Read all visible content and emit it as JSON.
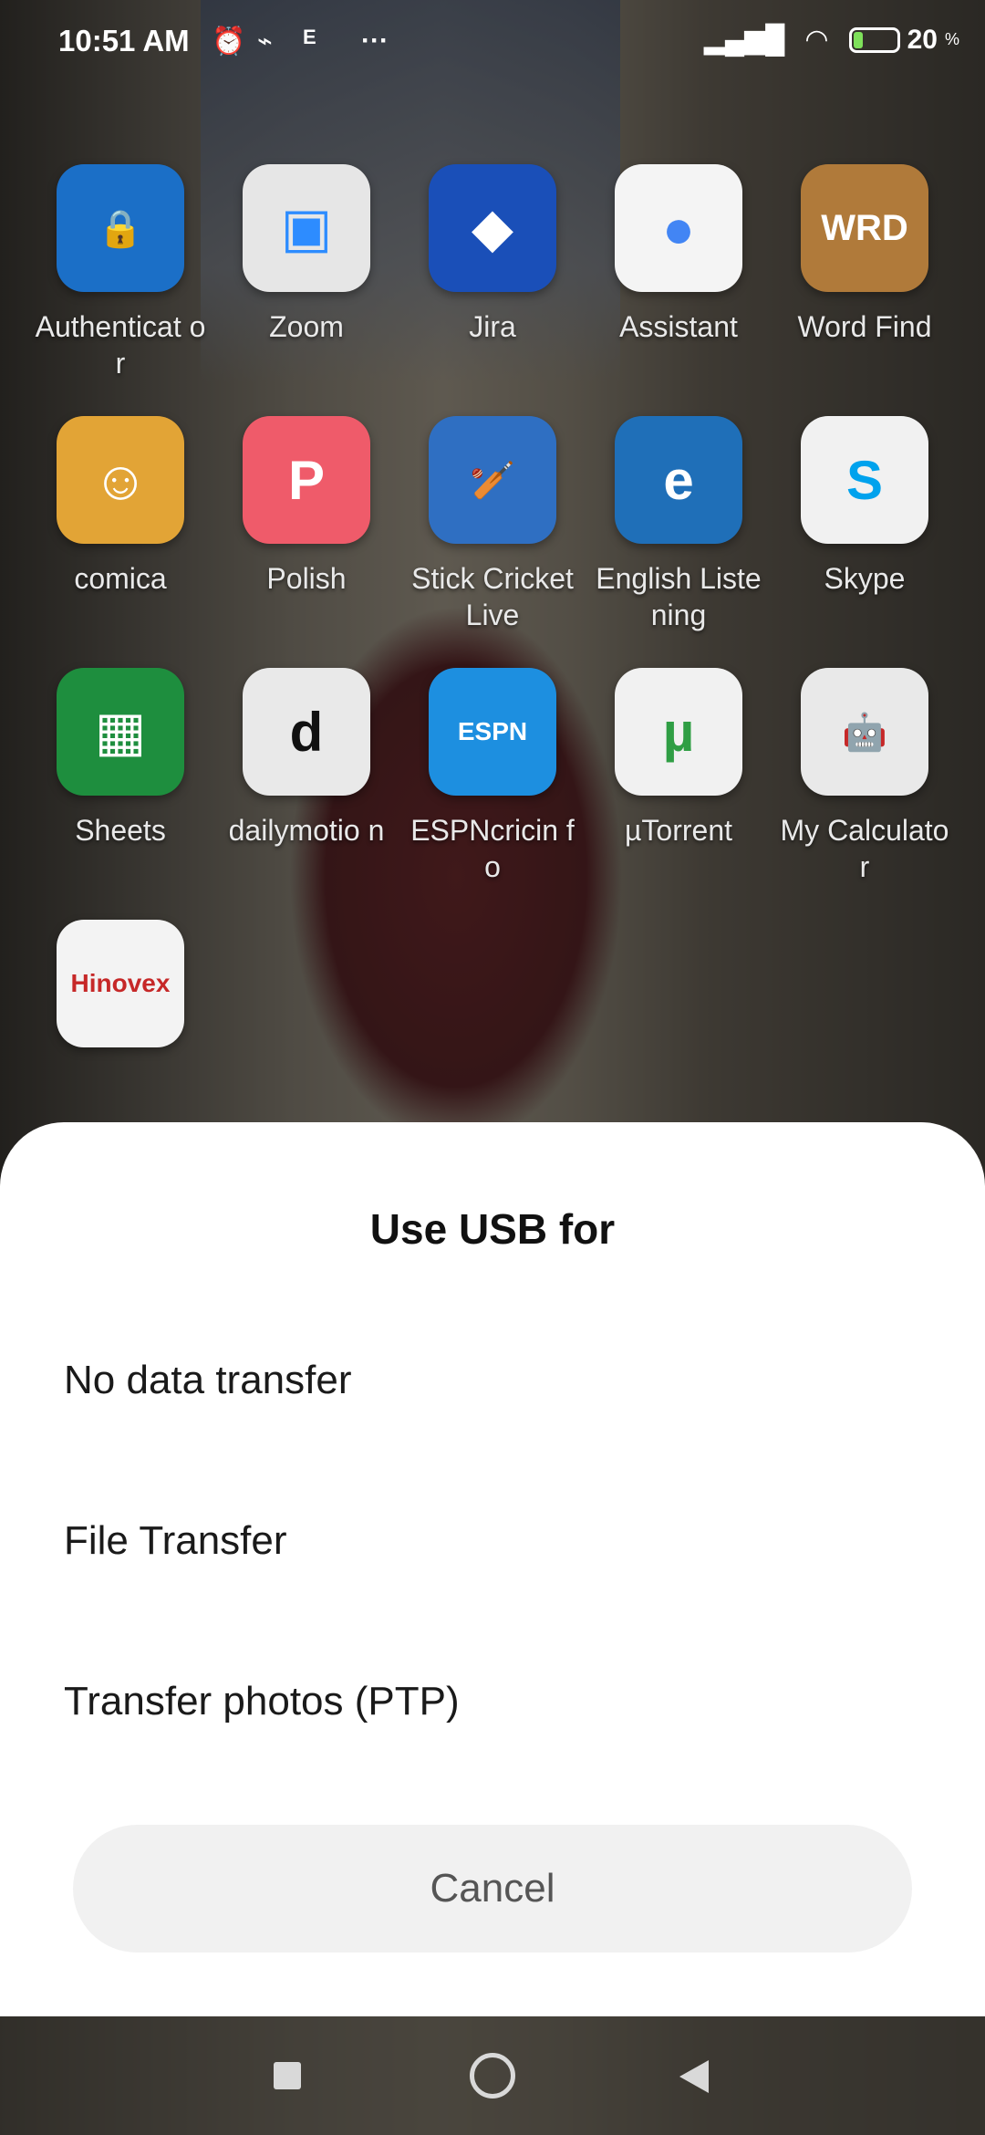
{
  "status_bar": {
    "time": "10:51 AM",
    "more": "···",
    "battery_percent": "20",
    "battery_unit": "%",
    "battery_level": 0.2,
    "icons": [
      "alarm-icon",
      "usb-icon",
      "espn-notification-icon",
      "signal-icon",
      "wifi-icon",
      "battery-charging-icon"
    ]
  },
  "apps": [
    {
      "name": "Authenticator",
      "label": "Authenticat or",
      "color": "#1b6fc7",
      "glyph": "🔒",
      "icon": "authenticator-icon"
    },
    {
      "name": "Zoom",
      "label": "Zoom",
      "color": "#e6e6e6",
      "glyph": "▣",
      "icon": "zoom-icon",
      "fg": "#2d8cff"
    },
    {
      "name": "Jira",
      "label": "Jira",
      "color": "#1a4fb8",
      "glyph": "◆",
      "icon": "jira-icon"
    },
    {
      "name": "Assistant",
      "label": "Assistant",
      "color": "#f4f4f4",
      "glyph": "●",
      "icon": "assistant-icon",
      "fg": "#4285f4"
    },
    {
      "name": "Word Find",
      "label": "Word Find",
      "color": "#b07a3a",
      "glyph": "WRD",
      "icon": "word-find-icon"
    },
    {
      "name": "comica",
      "label": "comica",
      "color": "#e2a436",
      "glyph": "☺",
      "icon": "comica-icon"
    },
    {
      "name": "Polish",
      "label": "Polish",
      "color": "#ef5b6a",
      "glyph": "P",
      "icon": "polish-icon"
    },
    {
      "name": "Stick Cricket Live",
      "label": "Stick Cricket Live",
      "color": "#2f6fc2",
      "glyph": "🏏",
      "icon": "stick-cricket-icon"
    },
    {
      "name": "English Listening",
      "label": "English Listening",
      "color": "#1f6fb8",
      "glyph": "e",
      "icon": "english-listening-icon"
    },
    {
      "name": "Skype",
      "label": "Skype",
      "color": "#f1f1f1",
      "glyph": "S",
      "icon": "skype-icon",
      "fg": "#00a2ed"
    },
    {
      "name": "Sheets",
      "label": "Sheets",
      "color": "#1e8e3e",
      "glyph": "▦",
      "icon": "sheets-icon"
    },
    {
      "name": "dailymotion",
      "label": "dailymotio n",
      "color": "#e9e9e9",
      "glyph": "d",
      "icon": "dailymotion-icon",
      "fg": "#111"
    },
    {
      "name": "ESPNcricinfo",
      "label": "ESPNcricin fo",
      "color": "#1d8fe0",
      "glyph": "ESPN",
      "icon": "espncricinfo-icon"
    },
    {
      "name": "µTorrent",
      "label": "µTorrent",
      "color": "#f1f1f1",
      "glyph": "µ",
      "icon": "utorrent-icon",
      "fg": "#2f9e44"
    },
    {
      "name": "My Calculator",
      "label": "My Calculator",
      "color": "#e9e9e9",
      "glyph": "🤖",
      "icon": "android-icon",
      "fg": "#7cb342"
    },
    {
      "name": "Hinovex",
      "label": "",
      "color": "#f3f3f3",
      "glyph": "Hinovex",
      "icon": "hinovex-icon",
      "fg": "#c62828"
    }
  ],
  "dialog": {
    "title": "Use USB for",
    "options": [
      "No data transfer",
      "File Transfer",
      "Transfer photos (PTP)"
    ],
    "cancel": "Cancel"
  },
  "nav": {
    "buttons": [
      "recents-icon",
      "home-icon",
      "back-icon"
    ]
  }
}
